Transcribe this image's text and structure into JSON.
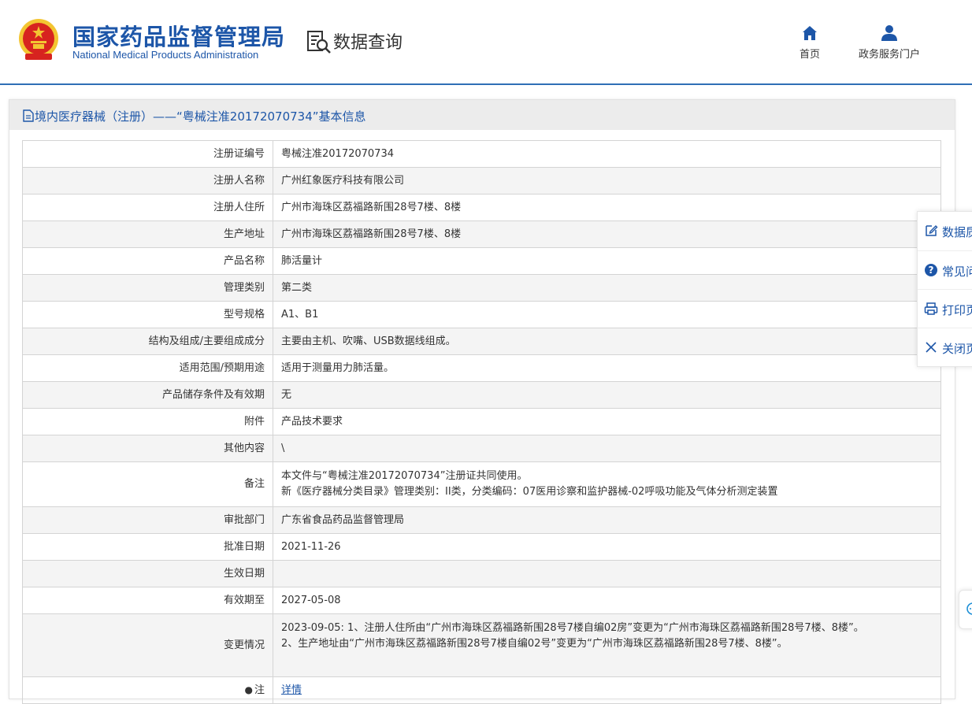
{
  "header": {
    "org_name_cn": "国家药品监督管理局",
    "org_name_en": "National Medical Products Administration",
    "section_title": "数据查询",
    "nav": [
      {
        "label": "首页",
        "icon": "home-icon"
      },
      {
        "label": "政务服务门户",
        "icon": "user-icon"
      }
    ]
  },
  "panel": {
    "title": "境内医疗器械（注册）——“粤械注准20172070734”基本信息",
    "rows": [
      {
        "key": "注册证编号",
        "value": "粤械注准20172070734"
      },
      {
        "key": "注册人名称",
        "value": "广州红象医疗科技有限公司"
      },
      {
        "key": "注册人住所",
        "value": "广州市海珠区荔福路新围28号7楼、8楼"
      },
      {
        "key": "生产地址",
        "value": "广州市海珠区荔福路新围28号7楼、8楼"
      },
      {
        "key": "产品名称",
        "value": "肺活量计"
      },
      {
        "key": "管理类别",
        "value": "第二类"
      },
      {
        "key": "型号规格",
        "value": "A1、B1"
      },
      {
        "key": "结构及组成/主要组成成分",
        "value": "主要由主机、吹嘴、USB数据线组成。"
      },
      {
        "key": "适用范围/预期用途",
        "value": "适用于测量用力肺活量。"
      },
      {
        "key": "产品储存条件及有效期",
        "value": "无"
      },
      {
        "key": "附件",
        "value": "产品技术要求"
      },
      {
        "key": "其他内容",
        "value": "\\"
      },
      {
        "key": "备注",
        "lines": [
          "本文件与“粤械注准20172070734”注册证共同使用。",
          "新《医疗器械分类目录》管理类别：II类，分类编码：07医用诊察和监护器械-02呼吸功能及气体分析测定装置"
        ]
      },
      {
        "key": "审批部门",
        "value": "广东省食品药品监督管理局"
      },
      {
        "key": "批准日期",
        "value": "2021-11-26"
      },
      {
        "key": "生效日期",
        "value": ""
      },
      {
        "key": "有效期至",
        "value": "2027-05-08"
      },
      {
        "key": "变更情况",
        "lines": [
          "2023-09-05: 1、注册人住所由“广州市海珠区荔福路新围28号7楼自编02房”变更为“广州市海珠区荔福路新围28号7楼、8楼”。",
          "2、生产地址由“广州市海珠区荔福路新围28号7楼自编02号”变更为“广州市海珠区荔福路新围28号7楼、8楼”。"
        ]
      },
      {
        "key": "注",
        "bullet": "●",
        "link": "详情"
      }
    ]
  },
  "sidebar": {
    "items": [
      {
        "label": "数据质",
        "icon": "edit-icon"
      },
      {
        "label": "常见问",
        "icon": "question-icon"
      },
      {
        "label": "打印页",
        "icon": "printer-icon"
      },
      {
        "label": "关闭页",
        "icon": "close-icon"
      }
    ]
  },
  "colors": {
    "brand_blue": "#1d56a8",
    "header_rule": "#2f6fb6",
    "emblem_red": "#d7231f",
    "emblem_gold": "#f3c532",
    "row_alt": "#f4f4f4"
  }
}
